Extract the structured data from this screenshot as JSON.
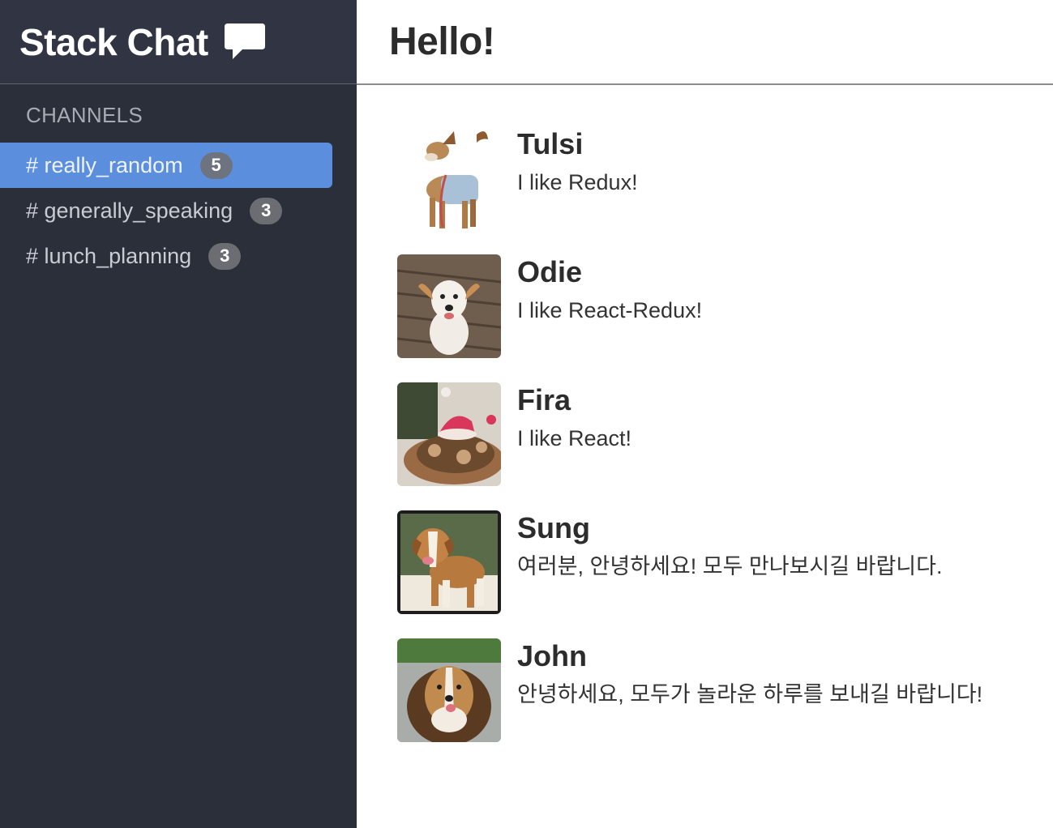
{
  "sidebar": {
    "brand": {
      "title": "Stack Chat",
      "icon": "chat-bubble-icon"
    },
    "channels_heading": "CHANNELS",
    "channels": [
      {
        "label": "# really_random",
        "count": "5",
        "active": true
      },
      {
        "label": "# generally_speaking",
        "count": "3",
        "active": false
      },
      {
        "label": "# lunch_planning",
        "count": "3",
        "active": false
      }
    ]
  },
  "main": {
    "title": "Hello!",
    "messages": [
      {
        "author": "Tulsi",
        "text": "I like Redux!"
      },
      {
        "author": "Odie",
        "text": "I like React-Redux!"
      },
      {
        "author": "Fira",
        "text": "I like React!"
      },
      {
        "author": "Sung",
        "text": "여러분, 안녕하세요! 모두 만나보시길 바랍니다."
      },
      {
        "author": "John",
        "text": "안녕하세요, 모두가 놀라운 하루를 보내길 바랍니다!"
      }
    ]
  },
  "colors": {
    "sidebar_bg": "#2b2f3a",
    "brand_bg": "#313543",
    "active_channel": "#5b8fde",
    "badge": "#6b6d72"
  }
}
